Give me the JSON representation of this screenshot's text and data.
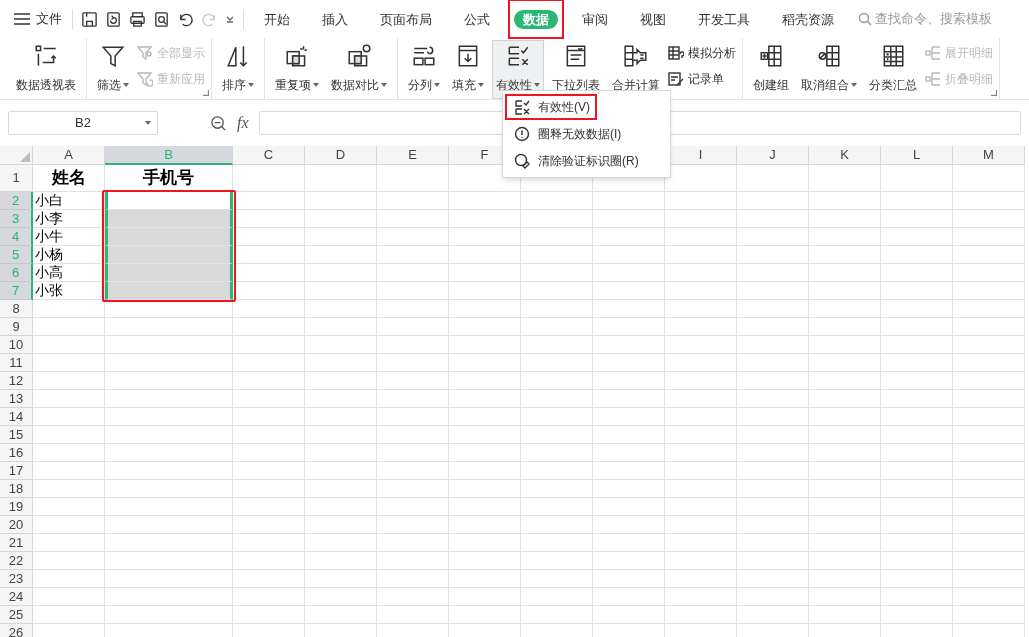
{
  "menu": {
    "file_label": "文件",
    "tabs": [
      {
        "label": "开始",
        "selected": false,
        "highlighted": false
      },
      {
        "label": "插入",
        "selected": false,
        "highlighted": false
      },
      {
        "label": "页面布局",
        "selected": false,
        "highlighted": false
      },
      {
        "label": "公式",
        "selected": false,
        "highlighted": false
      },
      {
        "label": "数据",
        "selected": true,
        "highlighted": true
      },
      {
        "label": "审阅",
        "selected": false,
        "highlighted": false
      },
      {
        "label": "视图",
        "selected": false,
        "highlighted": false
      },
      {
        "label": "开发工具",
        "selected": false,
        "highlighted": false
      },
      {
        "label": "稻壳资源",
        "selected": false,
        "highlighted": false
      }
    ],
    "search": {
      "placeholder": "查找命令、搜索模板"
    }
  },
  "ribbon": {
    "groups": [
      {
        "launcher": false,
        "items": [
          {
            "kind": "large",
            "label": "数据透视表",
            "dropdown": false,
            "pressed": false
          }
        ]
      },
      {
        "launcher": true,
        "items": [
          {
            "kind": "large",
            "label": "筛选",
            "dropdown": true,
            "pressed": false
          },
          {
            "kind": "small",
            "label": "全部显示",
            "disabled": true
          },
          {
            "kind": "small",
            "label": "重新应用",
            "disabled": true
          }
        ]
      },
      {
        "launcher": false,
        "items": [
          {
            "kind": "large",
            "label": "排序",
            "dropdown": true,
            "pressed": false
          }
        ]
      },
      {
        "launcher": false,
        "items": [
          {
            "kind": "large",
            "label": "重复项",
            "dropdown": true,
            "pressed": false
          },
          {
            "kind": "large",
            "label": "数据对比",
            "dropdown": true,
            "pressed": false
          }
        ]
      },
      {
        "launcher": false,
        "items": [
          {
            "kind": "large",
            "label": "分列",
            "dropdown": true,
            "pressed": false
          },
          {
            "kind": "large",
            "label": "填充",
            "dropdown": true,
            "pressed": false
          },
          {
            "kind": "large",
            "label": "有效性",
            "dropdown": true,
            "pressed": true
          },
          {
            "kind": "large",
            "label": "下拉列表",
            "dropdown": false,
            "pressed": false
          },
          {
            "kind": "large",
            "label": "合并计算",
            "dropdown": false,
            "pressed": false
          },
          {
            "kind": "small",
            "label": "模拟分析",
            "disabled": false
          },
          {
            "kind": "small",
            "label": "记录单",
            "disabled": false
          }
        ]
      },
      {
        "launcher": true,
        "items": [
          {
            "kind": "large",
            "label": "创建组",
            "dropdown": false,
            "pressed": false
          },
          {
            "kind": "large",
            "label": "取消组合",
            "dropdown": true,
            "pressed": false
          },
          {
            "kind": "large",
            "label": "分类汇总",
            "dropdown": false,
            "pressed": false
          },
          {
            "kind": "small",
            "label": "展开明细",
            "disabled": true
          },
          {
            "kind": "small",
            "label": "折叠明细",
            "disabled": true
          }
        ]
      }
    ]
  },
  "dropdown_menu": {
    "items": [
      {
        "label": "有效性(V)",
        "highlighted": true
      },
      {
        "label": "圈释无效数据(I)",
        "highlighted": false
      },
      {
        "label": "清除验证标识圈(R)",
        "highlighted": false
      }
    ]
  },
  "formula_bar": {
    "name_box": "B2",
    "function_label": "fx"
  },
  "sheet": {
    "selection_highlighted": true,
    "columns": [
      {
        "label": "A",
        "selected": false
      },
      {
        "label": "B",
        "selected": true
      },
      {
        "label": "C",
        "selected": false
      },
      {
        "label": "D",
        "selected": false
      },
      {
        "label": "E",
        "selected": false
      },
      {
        "label": "F",
        "selected": false
      },
      {},
      {},
      {
        "label": "I",
        "selected": false
      },
      {
        "label": "J",
        "selected": false
      },
      {
        "label": "K",
        "selected": false
      },
      {
        "label": "L",
        "selected": false
      },
      {
        "label": "M",
        "selected": false
      }
    ],
    "rows": [
      {
        "label": "1",
        "selected": false,
        "cells": [
          {
            "text": "姓名",
            "bold": true
          },
          {
            "text": "手机号",
            "bold": true
          }
        ]
      },
      {
        "label": "2",
        "selected": true,
        "cells": [
          {
            "text": "小白",
            "bold": false
          }
        ]
      },
      {
        "label": "3",
        "selected": true,
        "cells": [
          {
            "text": "小李",
            "bold": false
          }
        ]
      },
      {
        "label": "4",
        "selected": true,
        "cells": [
          {
            "text": "小牛",
            "bold": false
          }
        ]
      },
      {
        "label": "5",
        "selected": true,
        "cells": [
          {
            "text": "小杨",
            "bold": false
          }
        ]
      },
      {
        "label": "6",
        "selected": true,
        "cells": [
          {
            "text": "小高",
            "bold": false
          }
        ]
      },
      {
        "label": "7",
        "selected": true,
        "cells": [
          {
            "text": "小张",
            "bold": false
          }
        ]
      },
      {
        "label": "8",
        "selected": false
      },
      {
        "label": "9",
        "selected": false
      },
      {
        "label": "10",
        "selected": false
      },
      {
        "label": "11",
        "selected": false
      },
      {
        "label": "12",
        "selected": false
      },
      {
        "label": "13",
        "selected": false
      },
      {
        "label": "14",
        "selected": false
      },
      {
        "label": "15",
        "selected": false
      },
      {
        "label": "16",
        "selected": false
      },
      {
        "label": "17",
        "selected": false
      },
      {
        "label": "18",
        "selected": false
      },
      {
        "label": "19",
        "selected": false
      },
      {
        "label": "20",
        "selected": false
      },
      {
        "label": "21",
        "selected": false
      },
      {
        "label": "22",
        "selected": false
      },
      {
        "label": "23",
        "selected": false
      },
      {
        "label": "24",
        "selected": false
      },
      {
        "label": "25",
        "selected": false
      },
      {
        "label": "26",
        "selected": false
      }
    ]
  }
}
